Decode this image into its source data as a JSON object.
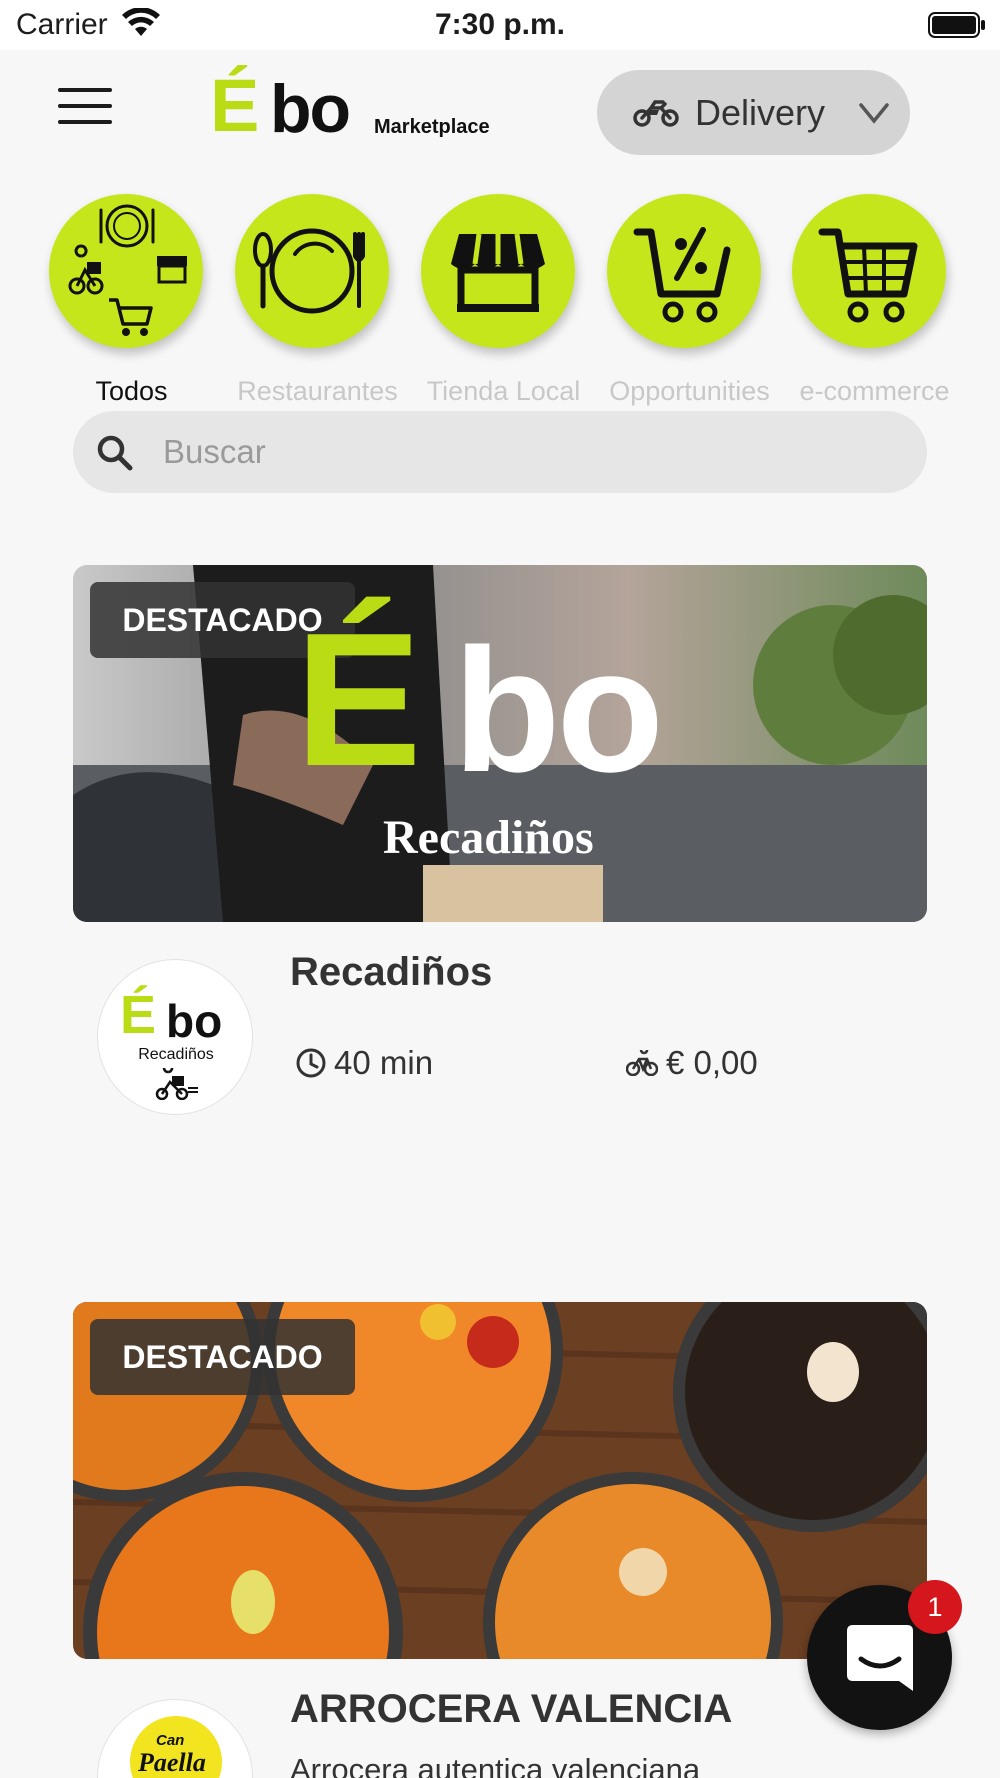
{
  "status_bar": {
    "carrier": "Carrier",
    "time": "7:30 p.m."
  },
  "header": {
    "logo_e": "É",
    "logo_bo": "bo",
    "logo_sub": "Marketplace",
    "delivery_label": "Delivery",
    "icons": {
      "menu": "hamburger-icon",
      "mode": "motorcycle-icon",
      "dropdown": "chevron-down-icon"
    }
  },
  "categories": [
    {
      "label": "Todos",
      "icon": "todos-icon",
      "active": true
    },
    {
      "label": "Restaurantes",
      "icon": "plate-cutlery-icon",
      "active": false
    },
    {
      "label": "Tienda Local",
      "icon": "storefront-icon",
      "active": false
    },
    {
      "label": "Opportunities",
      "icon": "discount-cart-icon",
      "active": false
    },
    {
      "label": "e-commerce",
      "icon": "shopping-cart-icon",
      "active": false
    }
  ],
  "search": {
    "placeholder": "Buscar"
  },
  "stores": [
    {
      "badge": "DESTACADO",
      "banner_title_e": "É",
      "banner_title_bo": "bo",
      "banner_subtitle": "Recadiños",
      "logo_e": "É",
      "logo_bo": "bo",
      "logo_sub": "Recadiños",
      "name": "Recadiños",
      "time": "40 min",
      "delivery_fee": "€ 0,00"
    },
    {
      "badge": "DESTACADO",
      "logo_line1": "Can",
      "logo_line2": "Paella",
      "name": "ARROCERA VALENCIA",
      "description": "Arrocera autentica valenciana"
    }
  ],
  "chat": {
    "unread": "1"
  },
  "colors": {
    "accent": "#c4e61a",
    "badge_red": "#d5161d",
    "background": "#f7f7f7"
  }
}
